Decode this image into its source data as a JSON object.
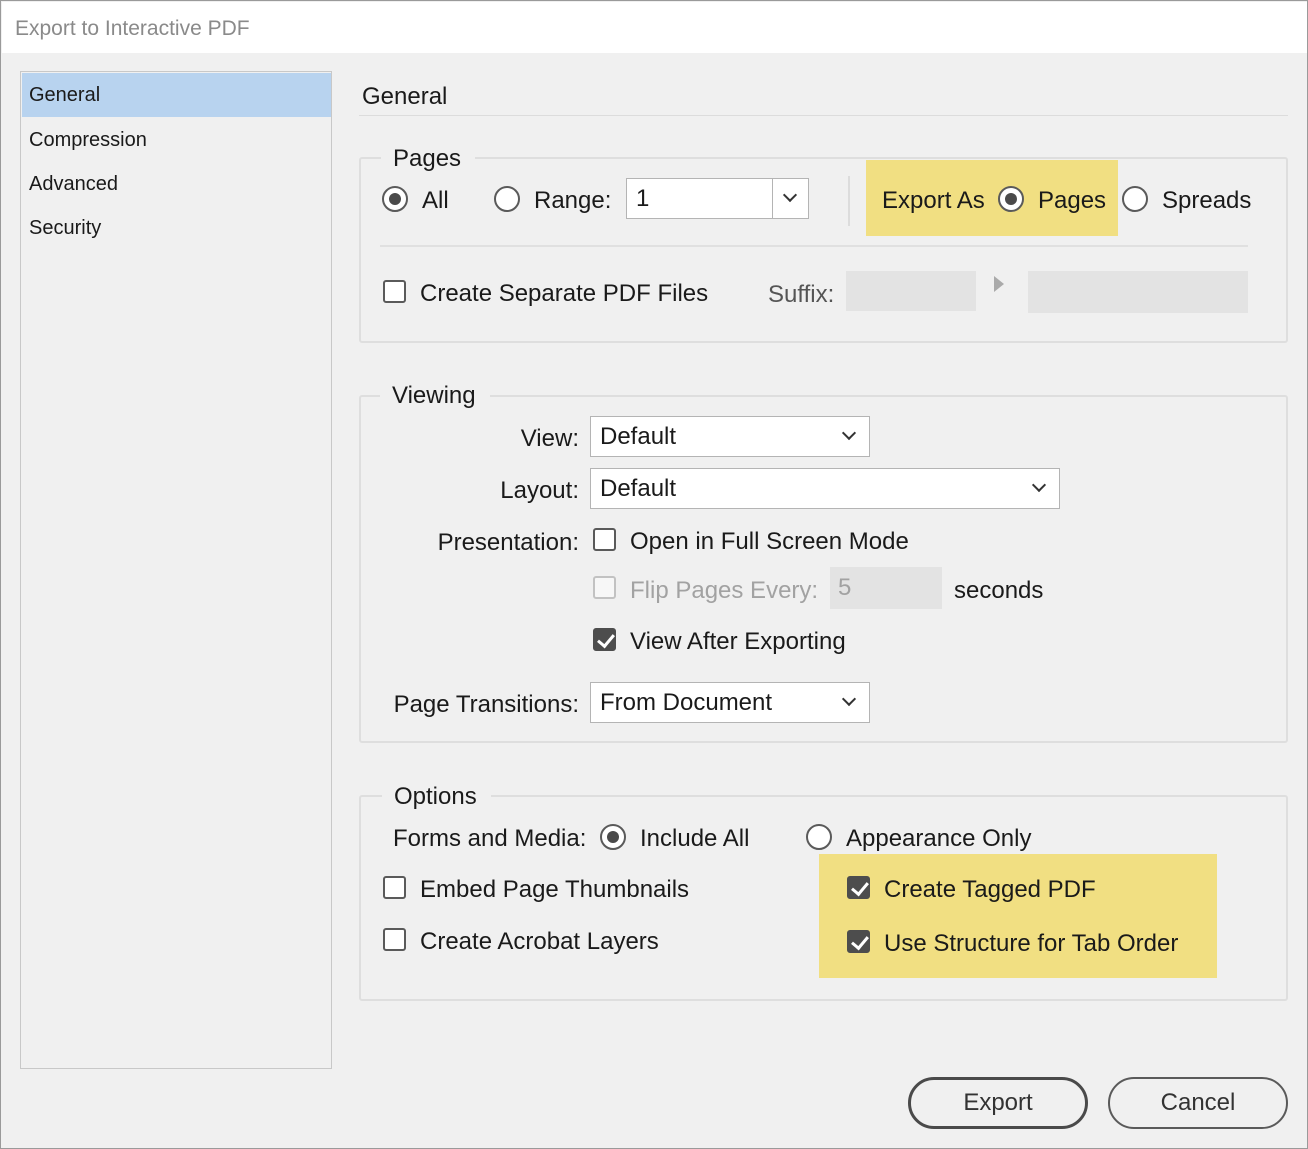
{
  "window": {
    "title": "Export to Interactive PDF"
  },
  "sidebar": {
    "items": [
      {
        "label": "General",
        "selected": true
      },
      {
        "label": "Compression",
        "selected": false
      },
      {
        "label": "Advanced",
        "selected": false
      },
      {
        "label": "Security",
        "selected": false
      }
    ]
  },
  "main": {
    "title": "General"
  },
  "pages": {
    "group_title": "Pages",
    "all_label": "All",
    "all_selected": true,
    "range_label": "Range:",
    "range_value": "1",
    "export_as_label": "Export As",
    "pages_label": "Pages",
    "pages_selected": true,
    "spreads_label": "Spreads",
    "create_separate_label": "Create Separate PDF Files",
    "create_separate_checked": false,
    "suffix_label": "Suffix:"
  },
  "viewing": {
    "group_title": "Viewing",
    "view_label": "View:",
    "view_value": "Default",
    "layout_label": "Layout:",
    "layout_value": "Default",
    "presentation_label": "Presentation:",
    "full_screen_label": "Open in Full Screen Mode",
    "full_screen_checked": false,
    "flip_label": "Flip Pages Every:",
    "flip_value": "5",
    "seconds_label": "seconds",
    "view_after_label": "View After Exporting",
    "view_after_checked": true,
    "transitions_label": "Page Transitions:",
    "transitions_value": "From Document"
  },
  "options": {
    "group_title": "Options",
    "forms_label": "Forms and Media:",
    "include_all_label": "Include All",
    "include_all_selected": true,
    "appearance_only_label": "Appearance Only",
    "embed_thumbnails_label": "Embed Page Thumbnails",
    "embed_thumbnails_checked": false,
    "acrobat_layers_label": "Create Acrobat Layers",
    "acrobat_layers_checked": false,
    "tagged_pdf_label": "Create Tagged PDF",
    "tagged_pdf_checked": true,
    "tab_order_label": "Use Structure for Tab Order",
    "tab_order_checked": true
  },
  "footer": {
    "export_label": "Export",
    "cancel_label": "Cancel"
  },
  "colors": {
    "highlight": "#f1df82",
    "selection": "#b8d3ef"
  }
}
